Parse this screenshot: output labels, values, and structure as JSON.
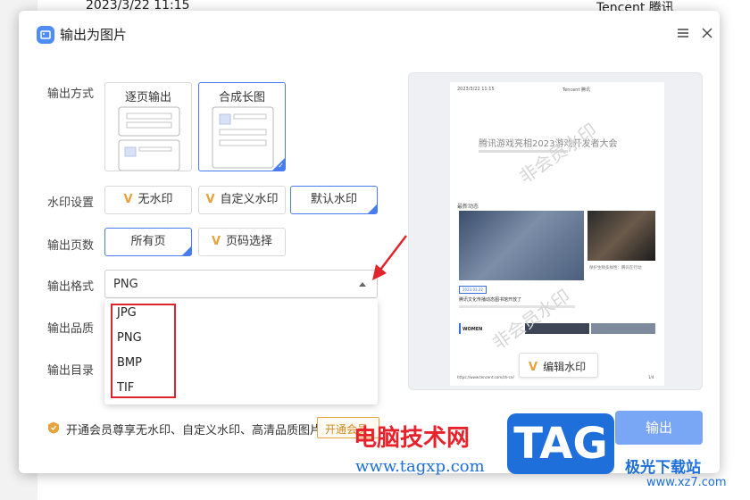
{
  "background": {
    "top_left_text": "2023/3/22 11:15",
    "top_right_text": "Tencent 腾讯"
  },
  "dialog": {
    "title": "输出为图片",
    "menu_icon": "hamburger-icon",
    "close_icon": "close-icon"
  },
  "labels": {
    "output_mode": "输出方式",
    "watermark": "水印设置",
    "pages": "输出页数",
    "format": "输出格式",
    "quality": "输出品质",
    "directory": "输出目录"
  },
  "output_mode": {
    "options": [
      "逐页输出",
      "合成长图"
    ],
    "selected": "合成长图"
  },
  "watermark": {
    "options": [
      "无水印",
      "自定义水印",
      "默认水印"
    ],
    "selected": "默认水印"
  },
  "pages": {
    "options": [
      "所有页",
      "页码选择"
    ],
    "selected": "所有页"
  },
  "format": {
    "value": "PNG",
    "options": [
      "JPG",
      "PNG",
      "BMP",
      "TIF"
    ]
  },
  "preview": {
    "header_left": "2023/3/22 11:15",
    "header_right": "Tencent 腾讯",
    "headline": "腾讯游戏亮相2023游戏开发者大会",
    "section": "最新动态",
    "tag": "2023.03.22",
    "caption": "腾讯文化传播动态图书馆开放了",
    "side_caption": "保护生物多样性：腾讯在行动",
    "watermark_text": "非会员水印",
    "footer_left": "https://www.tencent.com/zh-cn/",
    "footer_right": "1/4",
    "women": "WOMEN",
    "edit_watermark": "编辑水印"
  },
  "footer": {
    "promo": "开通会员尊享无水印、自定义水印、高清品质图片",
    "vip_button": "开通会员",
    "export_button": "输出"
  },
  "site_watermark": {
    "brand": "电脑技术网",
    "url": "www.tagxp.com",
    "tag": "TAG",
    "site_name": "极光下载站",
    "site_url": "www.xz7.com"
  },
  "colors": {
    "accent": "#4a7cf0",
    "export_button": "#7aa7f5",
    "highlight_box": "#d9262c",
    "vip": "#e6a23c"
  }
}
